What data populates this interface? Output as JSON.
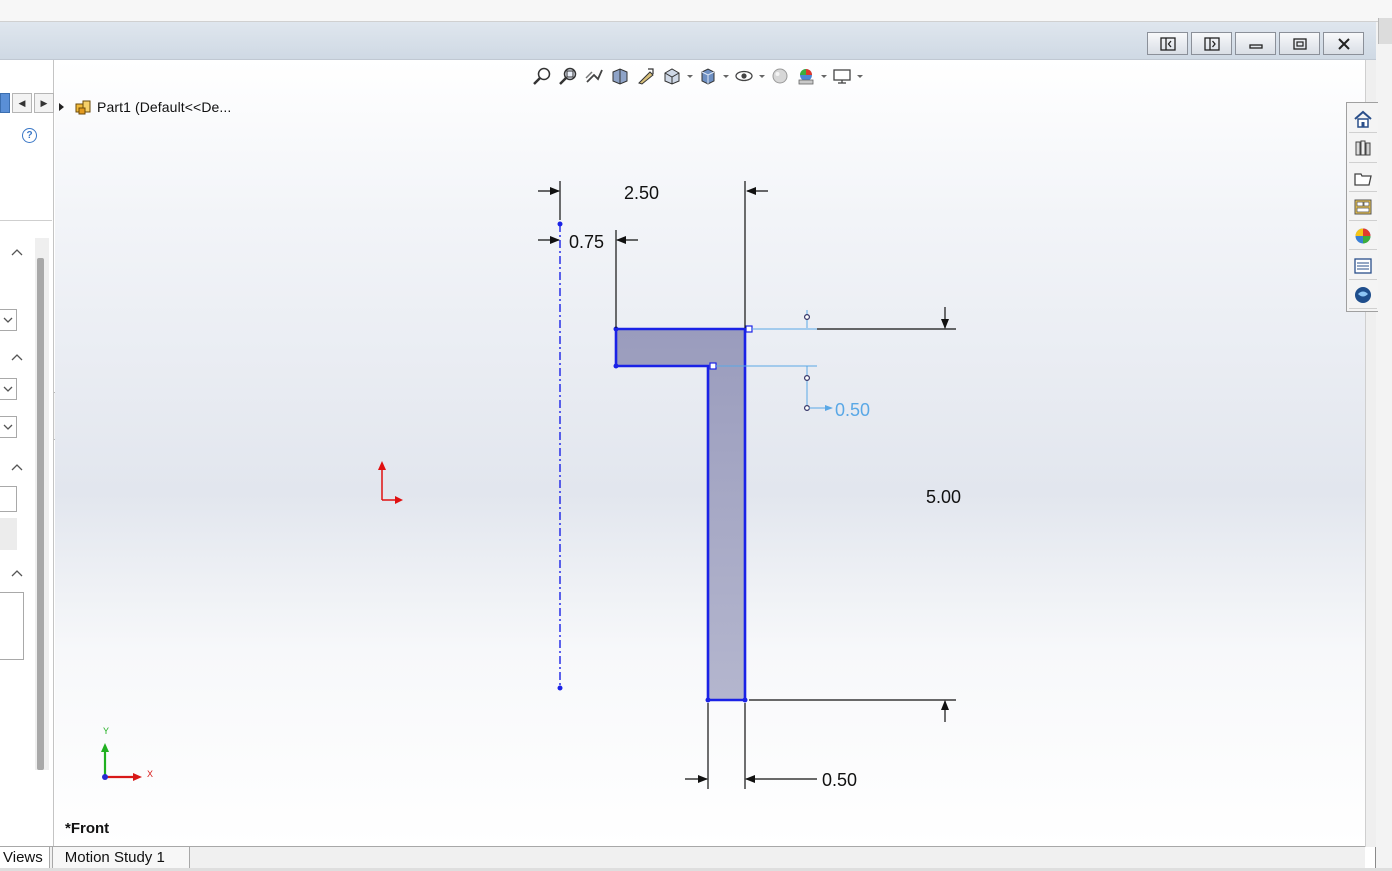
{
  "window": {
    "controls": [
      "tile-left-icon",
      "tile-right-icon",
      "minimize-icon",
      "restore-icon",
      "close-icon"
    ]
  },
  "left_pane": {
    "help_glyph": "?"
  },
  "feature_tree": {
    "root_label": "Part1  (Default<<De..."
  },
  "heads_up_toolbar": {
    "icons": [
      "zoom-to-fit-icon",
      "zoom-to-area-icon",
      "previous-view-icon",
      "section-view-icon",
      "dynamic-annotation-icon",
      "view-orientation-icon",
      "display-style-icon",
      "hide-show-items-icon",
      "edit-appearance-icon",
      "apply-scene-icon",
      "view-settings-icon"
    ]
  },
  "sketch": {
    "dimensions": {
      "width_overall": "2.50",
      "offset_left": "0.75",
      "flange_thickness": "0.50",
      "height_overall": "5.00",
      "web_thickness": "0.50"
    },
    "profile_color": "#1a22e6",
    "fill_color": "#9a9cbd",
    "driven_dimension_color": "#5aa8e6",
    "origin_color": "#e01010"
  },
  "triad": {
    "y_label": "Y",
    "x_label": "X"
  },
  "view": {
    "name": "*Front"
  },
  "task_pane": {
    "icons": [
      "solidworks-resources-icon",
      "design-library-icon",
      "file-explorer-icon",
      "view-palette-icon",
      "appearances-icon",
      "custom-properties-icon",
      "solidworks-forum-icon"
    ]
  },
  "bottom_tabs": {
    "tabs": [
      "Views",
      "Motion Study 1"
    ]
  }
}
